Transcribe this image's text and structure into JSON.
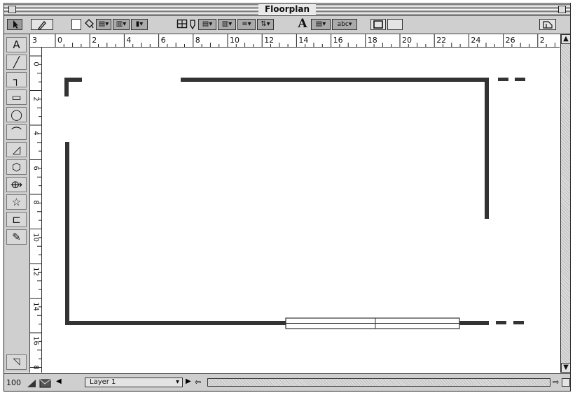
{
  "window": {
    "title": "Floorplan"
  },
  "toolbar": {
    "text_tool_glyph": "A",
    "fill_swatch_label": "",
    "text_style_label": "abc",
    "items": [
      "arrow-tool-icon",
      "pen-tool-icon",
      "fill-color-swatch",
      "paint-bucket-icon",
      "line-pattern-menu",
      "fill-pattern-menu",
      "shadow-menu",
      "grid-icon",
      "pencil-icon",
      "line-weight-menu",
      "dash-style-menu",
      "alignment-menu",
      "spacing-menu",
      "text-menu",
      "text-style-menu",
      "frame-button",
      "frame-off-button",
      "window-corner-icon"
    ]
  },
  "tools": [
    "text-tool",
    "line-tool",
    "connector-tool",
    "rectangle-tool",
    "oval-tool",
    "arc-tool",
    "freeform-tool",
    "polygon-tool",
    "shape-library-tool",
    "star-tool",
    "bracket-tool",
    "eyedropper-tool"
  ],
  "tool_glyphs": [
    "A",
    "╱",
    "┐",
    "▭",
    "◯",
    "⌒",
    "◿",
    "⬡",
    "⟴",
    "☆",
    "⊏",
    "✎"
  ],
  "ruler": {
    "horizontal_labels": [
      "3",
      "0",
      "2",
      "4",
      "6",
      "8",
      "10",
      "12",
      "14",
      "16",
      "18",
      "20",
      "22",
      "24",
      "26",
      "2"
    ],
    "vertical_labels": [
      "0",
      "2",
      "4",
      "6",
      "8",
      "10",
      "12",
      "14",
      "16",
      "8"
    ]
  },
  "status": {
    "zoom": "100",
    "layer": "Layer 1"
  },
  "colors": {
    "wall": "#333333",
    "window_fill": "#ffffff"
  }
}
